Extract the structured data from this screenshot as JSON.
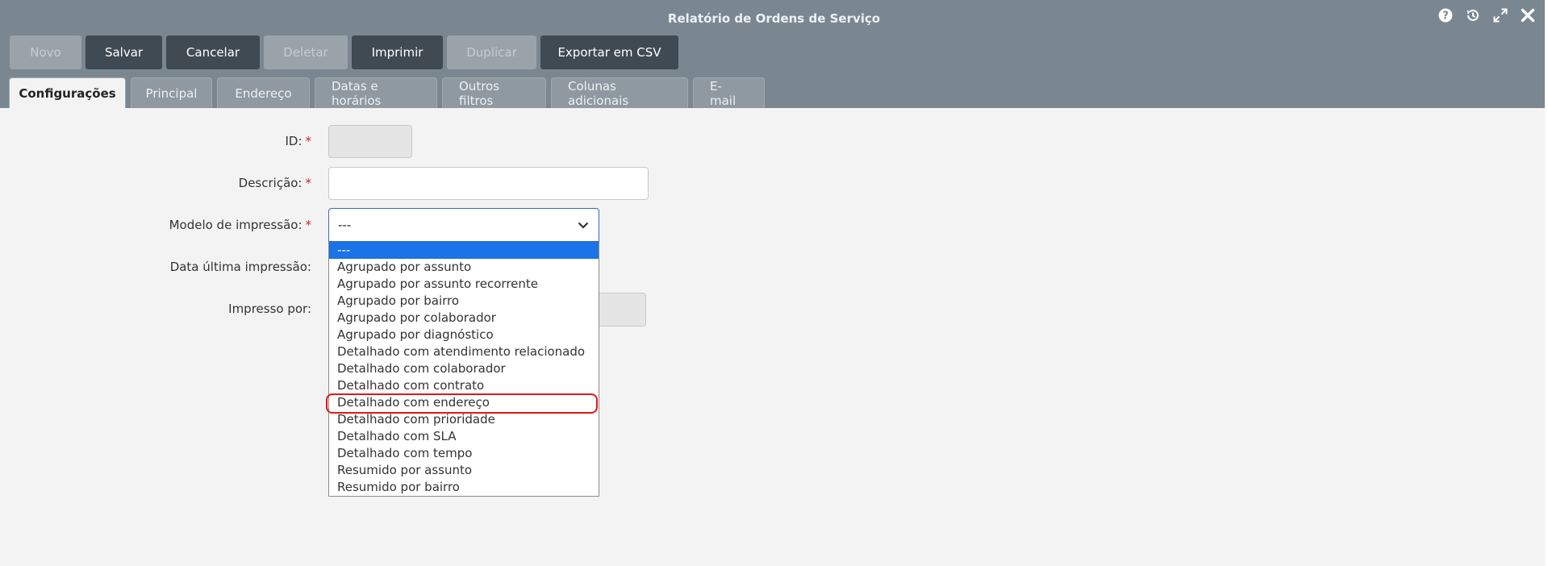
{
  "window": {
    "title": "Relatório de Ordens de Serviço"
  },
  "toolbar": {
    "buttons": [
      {
        "label": "Novo",
        "enabled": false
      },
      {
        "label": "Salvar",
        "enabled": true
      },
      {
        "label": "Cancelar",
        "enabled": true
      },
      {
        "label": "Deletar",
        "enabled": false
      },
      {
        "label": "Imprimir",
        "enabled": true
      },
      {
        "label": "Duplicar",
        "enabled": false
      },
      {
        "label": "Exportar em CSV",
        "enabled": true
      }
    ]
  },
  "tabs": [
    {
      "label": "Configurações",
      "active": true
    },
    {
      "label": "Principal",
      "active": false
    },
    {
      "label": "Endereço",
      "active": false
    },
    {
      "label": "Datas e horários",
      "active": false
    },
    {
      "label": "Outros filtros",
      "active": false
    },
    {
      "label": "Colunas adicionais",
      "active": false
    },
    {
      "label": "E-mail",
      "active": false
    }
  ],
  "form": {
    "id": {
      "label": "ID:",
      "required_mark": "*",
      "value": ""
    },
    "descricao": {
      "label": "Descrição:",
      "required_mark": "*",
      "value": ""
    },
    "modelo": {
      "label": "Modelo de impressão:",
      "required_mark": "*",
      "value": "---"
    },
    "data_ultima": {
      "label": "Data última impressão:"
    },
    "impresso_por": {
      "label": "Impresso por:"
    }
  },
  "dropdown": {
    "selected_index": 0,
    "highlighted_index": 9,
    "options": [
      "---",
      "Agrupado por assunto",
      "Agrupado por assunto recorrente",
      "Agrupado por bairro",
      "Agrupado por colaborador",
      "Agrupado por diagnóstico",
      "Detalhado com atendimento relacionado",
      "Detalhado com colaborador",
      "Detalhado com contrato",
      "Detalhado com endereço",
      "Detalhado com prioridade",
      "Detalhado com SLA",
      "Detalhado com tempo",
      "Resumido por assunto",
      "Resumido por bairro"
    ]
  },
  "colors": {
    "header_bg": "#7b8790",
    "button_dark": "#3f4a52",
    "button_disabled": "#9aa3aa",
    "selected_option": "#1a73e8",
    "highlight_outline": "#e01818",
    "required": "#d32020"
  },
  "icons": {
    "window_controls": [
      "help-icon",
      "history-icon",
      "expand-icon",
      "close-icon"
    ],
    "select_arrow": "chevron-down-icon"
  }
}
